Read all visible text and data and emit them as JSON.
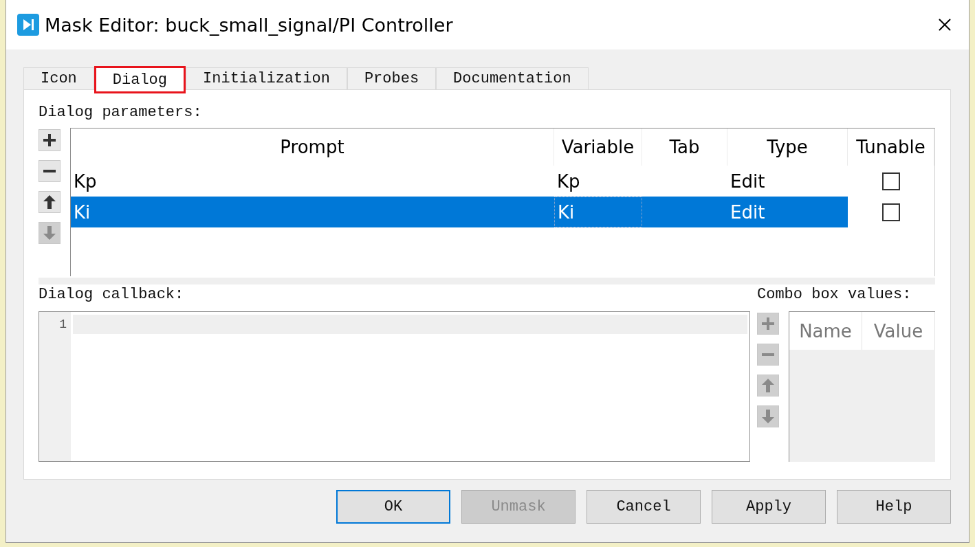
{
  "window": {
    "title": "Mask Editor: buck_small_signal/PI Controller"
  },
  "tabs": [
    {
      "label": "Icon",
      "selected": false,
      "outlined": false
    },
    {
      "label": "Dialog",
      "selected": true,
      "outlined": true
    },
    {
      "label": "Initialization",
      "selected": false,
      "outlined": false
    },
    {
      "label": "Probes",
      "selected": false,
      "outlined": false
    },
    {
      "label": "Documentation",
      "selected": false,
      "outlined": false
    }
  ],
  "parameters": {
    "label": "Dialog parameters:",
    "tools": [
      {
        "kind": "add",
        "disabled": false
      },
      {
        "kind": "remove",
        "disabled": false
      },
      {
        "kind": "up",
        "disabled": false
      },
      {
        "kind": "down",
        "disabled": true
      }
    ],
    "columns": [
      "Prompt",
      "Variable",
      "Tab",
      "Type",
      "Tunable"
    ],
    "rows": [
      {
        "prompt": "Kp",
        "variable": "Kp",
        "type": "Edit",
        "tunable": false,
        "selected": false
      },
      {
        "prompt": "Ki",
        "variable": "Ki",
        "type": "Edit",
        "tunable": false,
        "selected": true
      }
    ]
  },
  "callback": {
    "label": "Dialog callback:",
    "line_numbers": [
      "1"
    ]
  },
  "combo": {
    "label": "Combo box values:",
    "tools": [
      {
        "kind": "add",
        "disabled": true
      },
      {
        "kind": "remove",
        "disabled": true
      },
      {
        "kind": "up",
        "disabled": true
      },
      {
        "kind": "down",
        "disabled": true
      }
    ],
    "columns": [
      "Name",
      "Value"
    ]
  },
  "buttons": [
    {
      "label": "OK",
      "default": true,
      "disabled": false
    },
    {
      "label": "Unmask",
      "default": false,
      "disabled": true
    },
    {
      "label": "Cancel",
      "default": false,
      "disabled": false
    },
    {
      "label": "Apply",
      "default": false,
      "disabled": false
    },
    {
      "label": "Help",
      "default": false,
      "disabled": false
    }
  ]
}
